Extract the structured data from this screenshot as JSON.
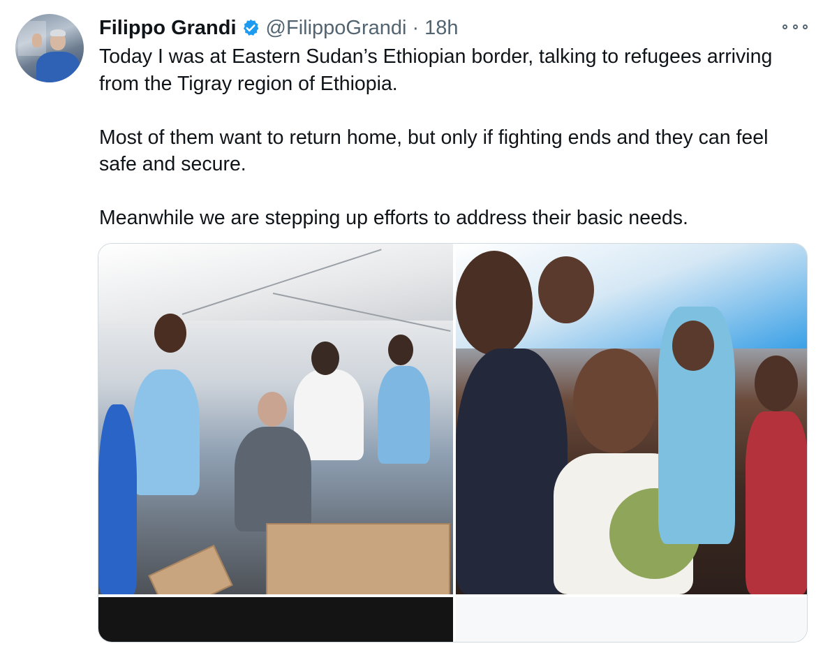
{
  "tweet": {
    "author": {
      "name": "Filippo Grandi",
      "handle": "@FilippoGrandi",
      "verified": true,
      "avatar_icon": "profile-photo"
    },
    "separator": "·",
    "time": "18h",
    "more_icon": "more-options-icon",
    "paragraphs": [
      "Today I was at Eastern Sudan’s Ethiopian border, talking to refugees arriving from the Tigray region of Ethiopia.",
      "Most of them want to return home, but only if fighting ends and they can feel safe and secure.",
      "Meanwhile we are stepping up efforts to address their basic needs."
    ],
    "media_count": 4
  },
  "colors": {
    "text_primary": "#0f1419",
    "text_secondary": "#536471",
    "verified_blue": "#1d9bf0",
    "border": "#cfd9de"
  }
}
